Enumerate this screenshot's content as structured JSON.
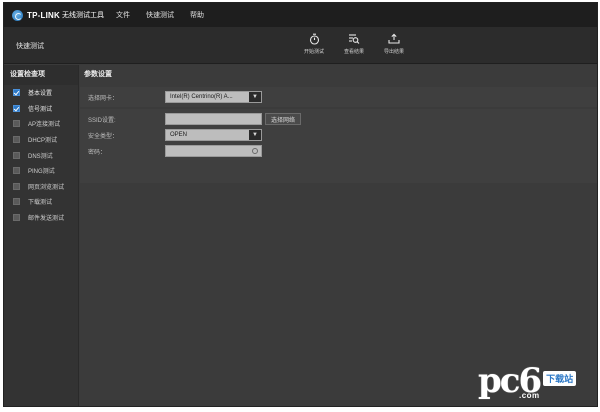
{
  "app": {
    "brand": "TP-LINK",
    "name": "无线测试工具"
  },
  "menu": [
    "文件",
    "快速测试",
    "帮助"
  ],
  "toolbar": {
    "title": "快速测试",
    "tools": [
      {
        "label": "开始测试",
        "icon": "stopwatch-icon"
      },
      {
        "label": "查看结果",
        "icon": "view-results-icon"
      },
      {
        "label": "导出结果",
        "icon": "export-icon"
      }
    ]
  },
  "sidebar": {
    "title": "设置检查项",
    "items": [
      {
        "label": "基本设置",
        "checked": true
      },
      {
        "label": "信号测试",
        "checked": true
      },
      {
        "label": "AP连接测试",
        "checked": false
      },
      {
        "label": "DHCP测试",
        "checked": false
      },
      {
        "label": "DNS测试",
        "checked": false
      },
      {
        "label": "PING测试",
        "checked": false
      },
      {
        "label": "网页浏览测试",
        "checked": false
      },
      {
        "label": "下载测试",
        "checked": false
      },
      {
        "label": "邮件发送测试",
        "checked": false
      }
    ]
  },
  "main": {
    "title": "参数设置",
    "adapter": {
      "label": "选择网卡：",
      "value": "Intel(R) Centrino(R) A..."
    },
    "ssid": {
      "label": "SSID设置:",
      "value": "",
      "button": "选择网络"
    },
    "security": {
      "label": "安全类型：",
      "value": "OPEN"
    },
    "password": {
      "label": "密码：",
      "value": ""
    }
  },
  "watermark": {
    "text": "pc6",
    "badge": "下载站",
    "site": ".com"
  },
  "colors": {
    "accent": "#2d79c7",
    "titlebar": "#1e1e1e",
    "background": "#3a3a3a"
  }
}
